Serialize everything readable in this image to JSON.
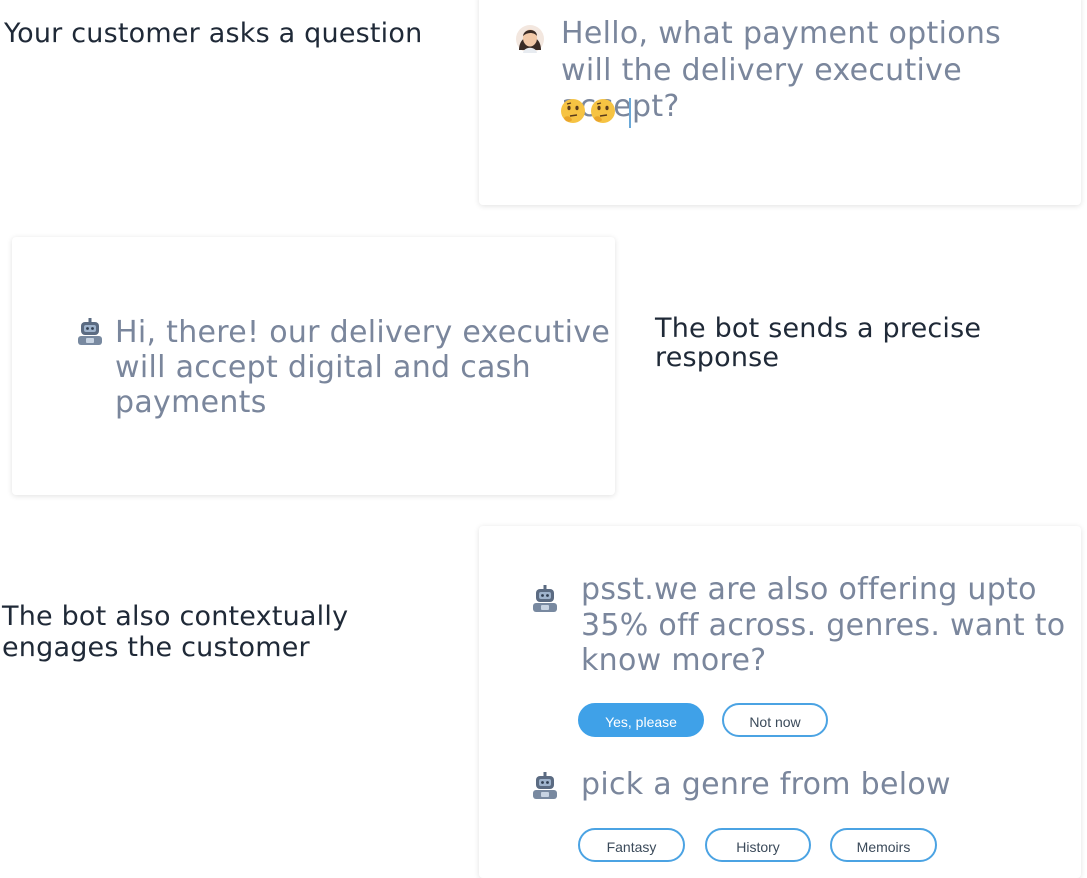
{
  "colors": {
    "caption_text": "#1f2937",
    "message_text": "#7a869c",
    "primary_chip": "#3fa1e8",
    "chip_border": "#4ba3e3"
  },
  "step1": {
    "caption": "Your customer asks a question",
    "message_line1": "Hello, what payment options",
    "message_line2": "will the delivery executive accept?",
    "avatar_icon": "customer-avatar-icon",
    "emojis": [
      "thinking-face-icon",
      "thinking-face-icon"
    ]
  },
  "step2": {
    "caption_line1": "The bot sends a precise",
    "caption_line2": "response",
    "message_line1": "Hi, there! our delivery executive",
    "message_line2": "will accept digital and cash",
    "message_line3": "payments",
    "bot_icon": "robot-icon"
  },
  "step3": {
    "caption_line1": "The bot also contextually",
    "caption_line2": "engages the customer",
    "offer_line1": "psst.we are also offering upto",
    "offer_line2": "35% off across. genres. want to",
    "offer_line3": "know more?",
    "reply_yes": "Yes, please",
    "reply_no": "Not now",
    "genre_prompt": "pick a genre from below",
    "genres": [
      "Fantasy",
      "History",
      "Memoirs"
    ]
  }
}
